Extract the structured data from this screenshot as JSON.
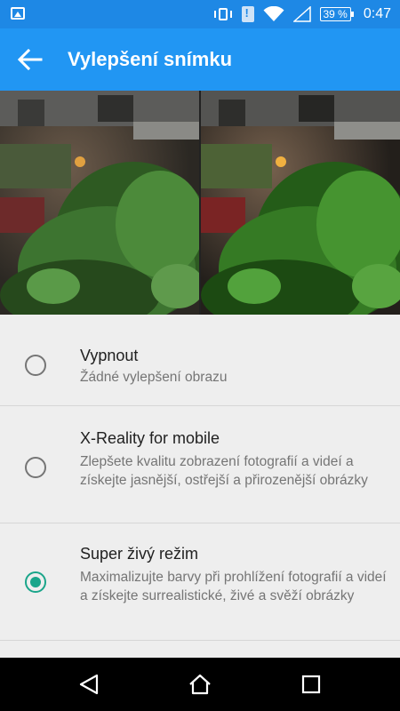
{
  "status_bar": {
    "battery": "39 %",
    "time": "0:47",
    "icons": [
      "image-notification-icon",
      "vibrate-icon",
      "sim-alert-icon",
      "wifi-icon",
      "signal-icon",
      "battery-icon"
    ]
  },
  "toolbar": {
    "title": "Vylepšení snímku",
    "back_icon": "arrow-back-icon"
  },
  "options": [
    {
      "title": "Vypnout",
      "description": "Žádné vylepšení obrazu",
      "selected": false
    },
    {
      "title": "X-Reality for mobile",
      "description": "Zlepšete kvalitu zobrazení fotografií a videí a získejte jasnější, ostřejší a přirozenější obrázky",
      "selected": false
    },
    {
      "title": "Super živý režim",
      "description": "Maximalizujte barvy při prohlížení fotografií a videí a získejte surrealistické, živé a svěží obrázky",
      "selected": true
    }
  ],
  "colors": {
    "status_bar": "#1e88e5",
    "toolbar": "#2196f3",
    "radio_selected": "#1aa58a"
  },
  "nav_bar": {
    "icons": [
      "back-triangle-icon",
      "home-icon",
      "recents-square-icon"
    ]
  }
}
